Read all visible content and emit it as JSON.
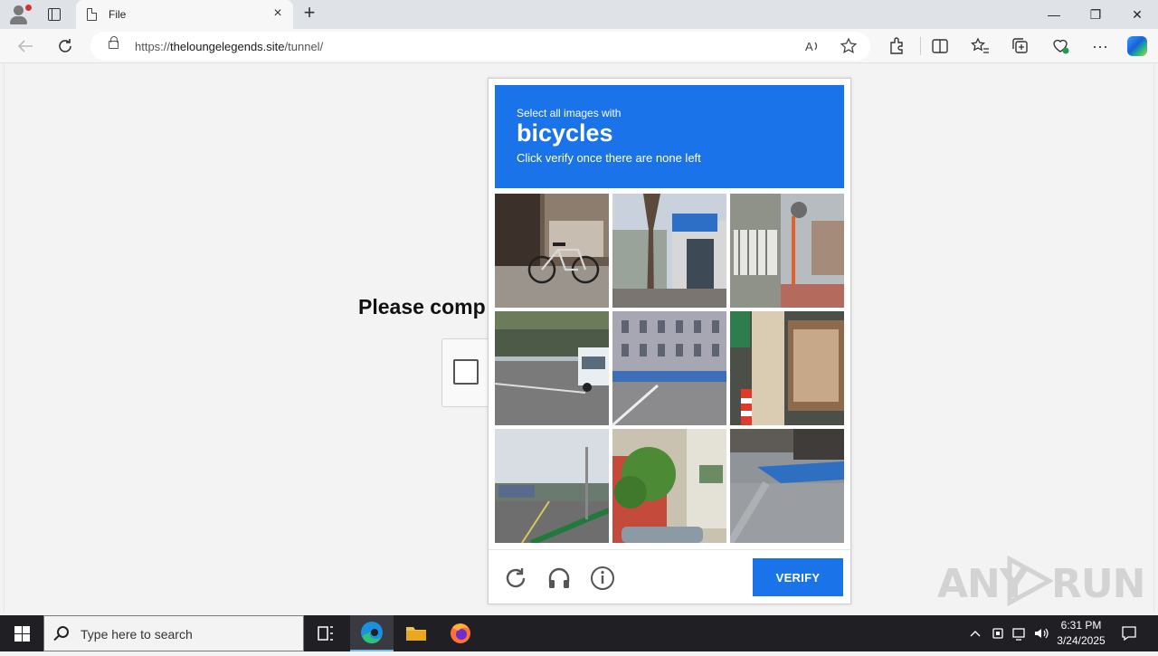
{
  "browser": {
    "tab_title": "File",
    "tab_close": "×",
    "new_tab": "+",
    "url_prefix": "https://",
    "url_domain": "theloungelegends.site",
    "url_path": "/tunnel/",
    "window_controls": {
      "minimize": "—",
      "restore": "❐",
      "close": "✕"
    }
  },
  "page": {
    "heading_partial": "Please comp"
  },
  "captcha": {
    "prompt_line1": "Select all images with",
    "prompt_target": "bicycles",
    "prompt_line3": "Click verify once there are none left",
    "verify_label": "VERIFY",
    "tiles": [
      "bicycle-by-building",
      "tree-and-shop",
      "street-corner-pole",
      "highway-truck",
      "european-building",
      "shop-column",
      "road-with-railing",
      "tree-and-car",
      "street-blue-paint"
    ],
    "header_color": "#1a73e8"
  },
  "watermark": {
    "text": "ANY RUN"
  },
  "taskbar": {
    "search_placeholder": "Type here to search",
    "time": "6:31 PM",
    "date": "3/24/2025"
  }
}
